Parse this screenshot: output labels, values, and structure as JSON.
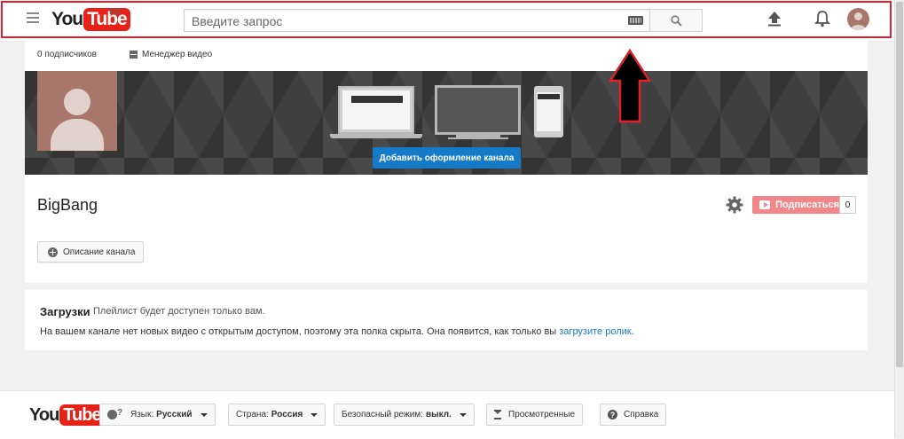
{
  "header": {
    "logo_you": "You",
    "logo_tube": "Tube",
    "logo_region": "RU",
    "search_placeholder": "Введите запрос",
    "icons": [
      "menu-icon",
      "keyboard-icon",
      "search-icon",
      "upload-icon",
      "bell-icon",
      "avatar"
    ]
  },
  "channel": {
    "subscribers": "0 подписчиков",
    "video_manager": "Менеджер видео",
    "add_art_label": "Добавить оформление канала",
    "name": "BigBang",
    "subscribe_label": "Подписаться",
    "subscriber_count": "0",
    "description_label": "Описание канала"
  },
  "uploads": {
    "title": "Загрузки",
    "note": "Плейлист будет доступен только вам.",
    "empty_message": "На вашем канале нет новых видео с открытым доступом, поэтому эта полка скрыта. Она появится, как только вы ",
    "empty_link": "загрузите ролик",
    "empty_suffix": "."
  },
  "footer": {
    "logo_you": "You",
    "logo_tube": "Tube",
    "language_label": "Язык:",
    "language_value": "Русский",
    "country_label": "Страна:",
    "country_value": "Россия",
    "safe_mode_label": "Безопасный режим:",
    "safe_mode_value": "выкл.",
    "history_label": "Просмотренные",
    "help_label": "Справка"
  },
  "colors": {
    "brand_red": "#e62117",
    "accent_blue": "#167ac6",
    "subscribe_pink": "#f2878a",
    "annotation_red": "#e0202a"
  }
}
